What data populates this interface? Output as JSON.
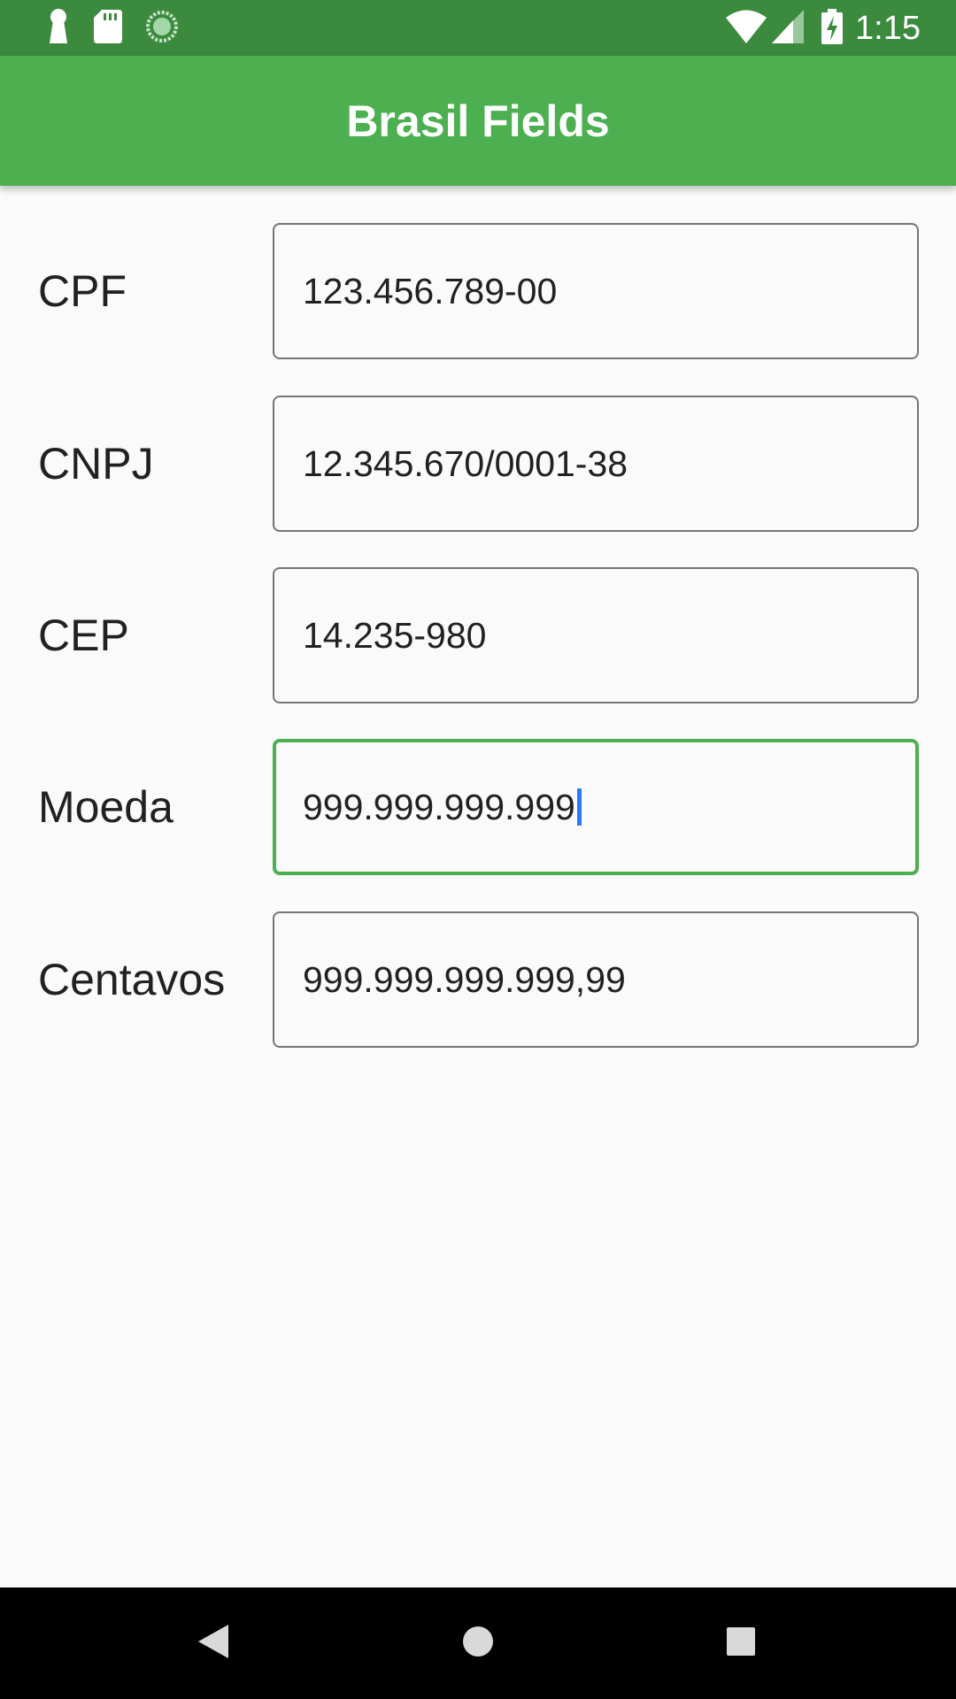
{
  "status_bar": {
    "time": "1:15",
    "left_icons": [
      "keyhole-icon",
      "sd-card-icon",
      "sync-icon"
    ],
    "right_icons": [
      "wifi-icon",
      "signal-icon",
      "battery-charging-icon"
    ]
  },
  "app_bar": {
    "title": "Brasil Fields"
  },
  "form": {
    "rows": [
      {
        "label": "CPF",
        "value": "123.456.789-00",
        "focused": false
      },
      {
        "label": "CNPJ",
        "value": "12.345.670/0001-38",
        "focused": false
      },
      {
        "label": "CEP",
        "value": "14.235-980",
        "focused": false
      },
      {
        "label": "Moeda",
        "value": "999.999.999.999",
        "focused": true
      },
      {
        "label": "Centavos",
        "value": "999.999.999.999,99",
        "focused": false
      }
    ]
  },
  "nav_bar": {
    "buttons": [
      "back-icon",
      "home-icon",
      "recents-icon"
    ]
  },
  "colors": {
    "status_bar": "#3b8a3e",
    "app_bar": "#4caf50",
    "focused_border": "#4caf50",
    "cursor": "#2979ff"
  }
}
